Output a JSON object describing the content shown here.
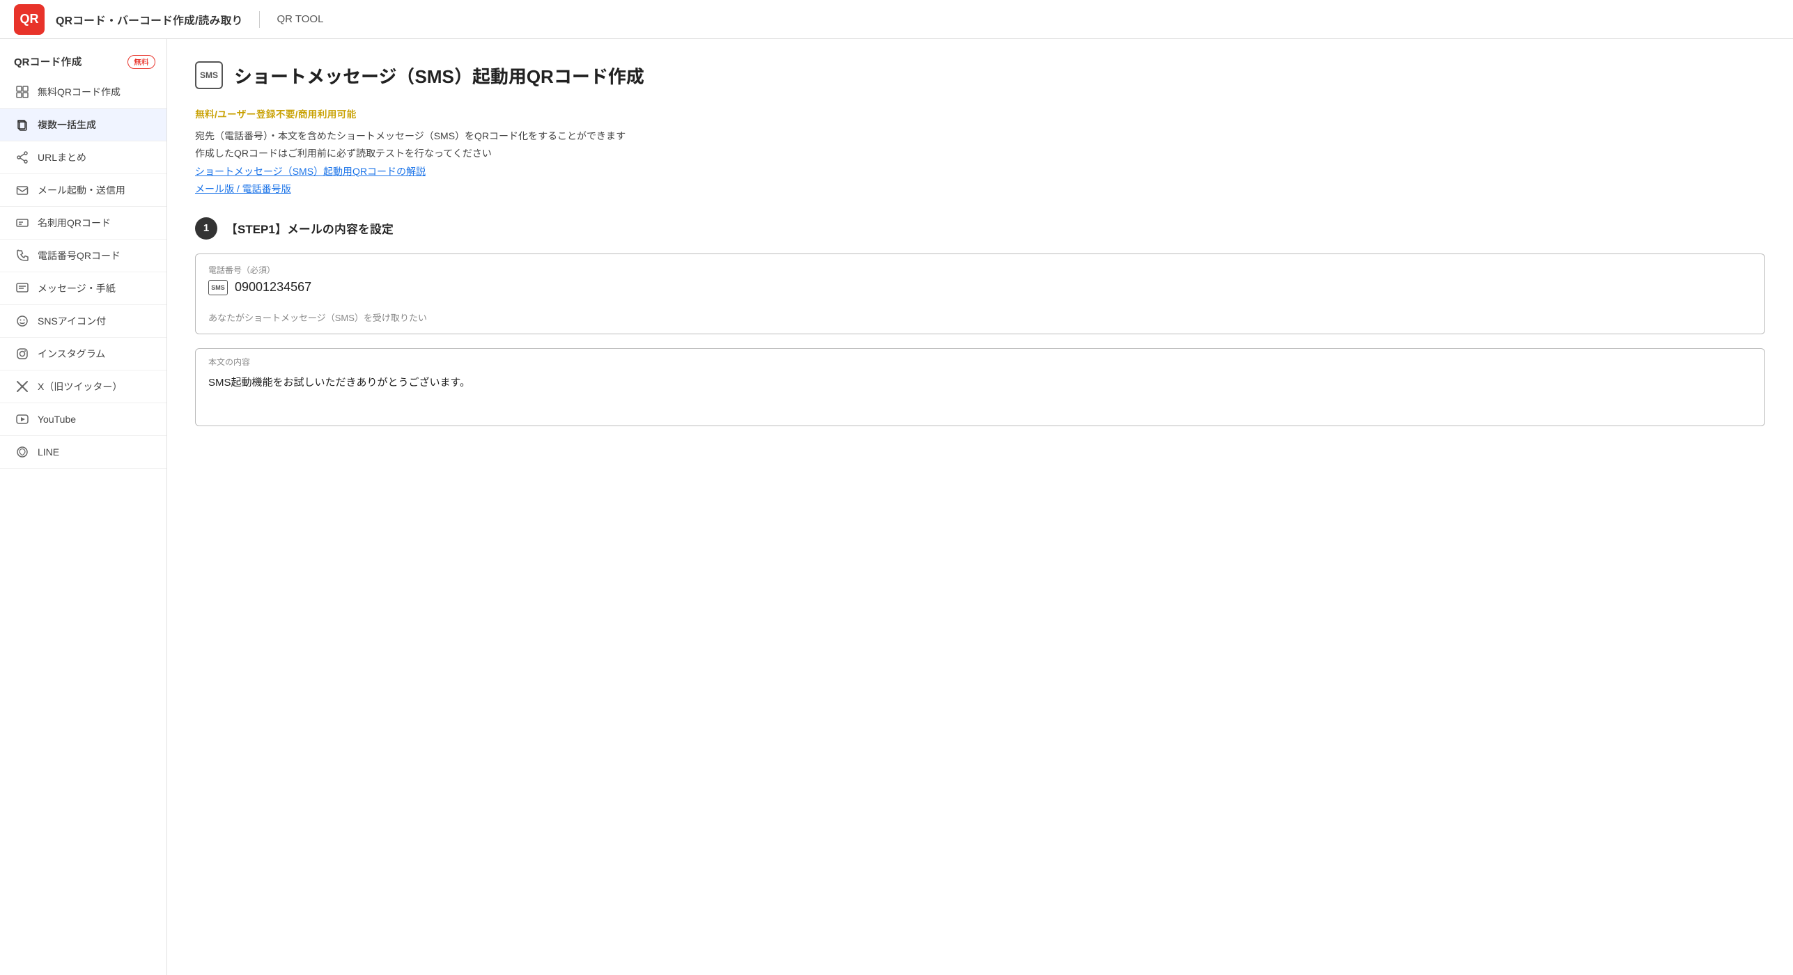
{
  "header": {
    "logo_text": "QR",
    "title": "QRコード・バーコード作成/読み取り",
    "subtitle": "QR TOOL"
  },
  "sidebar": {
    "section_title": "QRコード作成",
    "section_badge": "無料",
    "items": [
      {
        "id": "free-qr",
        "icon": "⊞",
        "label": "無料QRコード作成",
        "active": false
      },
      {
        "id": "bulk",
        "icon": "⧉",
        "label": "複数一括生成",
        "active": true
      },
      {
        "id": "url",
        "icon": "◁▷",
        "label": "URLまとめ",
        "active": false
      },
      {
        "id": "mail",
        "icon": "✉",
        "label": "メール起動・送信用",
        "active": false
      },
      {
        "id": "meishi",
        "icon": "▣",
        "label": "名刺用QRコード",
        "active": false
      },
      {
        "id": "phone",
        "icon": "☎",
        "label": "電話番号QRコード",
        "active": false
      },
      {
        "id": "message",
        "icon": "⊟",
        "label": "メッセージ・手紙",
        "active": false
      },
      {
        "id": "sns",
        "icon": "☺",
        "label": "SNSアイコン付",
        "active": false
      },
      {
        "id": "instagram",
        "icon": "⊙",
        "label": "インスタグラム",
        "active": false
      },
      {
        "id": "twitter",
        "icon": "✕",
        "label": "X（旧ツイッター）",
        "active": false
      },
      {
        "id": "youtube",
        "icon": "▶",
        "label": "YouTube",
        "active": false
      },
      {
        "id": "line",
        "icon": "◎",
        "label": "LINE",
        "active": false
      }
    ]
  },
  "main": {
    "page_title": "ショートメッセージ（SMS）起動用QRコード作成",
    "page_title_icon": "SMS",
    "highlight_text": "無料/ユーザー登録不要/商用利用可能",
    "desc_line1": "宛先（電話番号）・本文を含めたショートメッセージ（SMS）をQRコード化をすることができます",
    "desc_line2": "作成したQRコードはご利用前に必ず読取テストを行なってください",
    "desc_link": "ショートメッセージ（SMS）起動用QRコードの解説",
    "desc_versions": "メール版 / 電話番号版",
    "step1_badge": "1",
    "step1_title": "【STEP1】メールの内容を設定",
    "phone_label": "電話番号（必須）",
    "phone_icon": "SMS",
    "phone_value": "09001234567",
    "phone_hint": "あなたがショートメッセージ（SMS）を受け取りたい",
    "body_label": "本文の内容",
    "body_value": "SMS起動機能をお試しいただきありがとうございます。"
  }
}
